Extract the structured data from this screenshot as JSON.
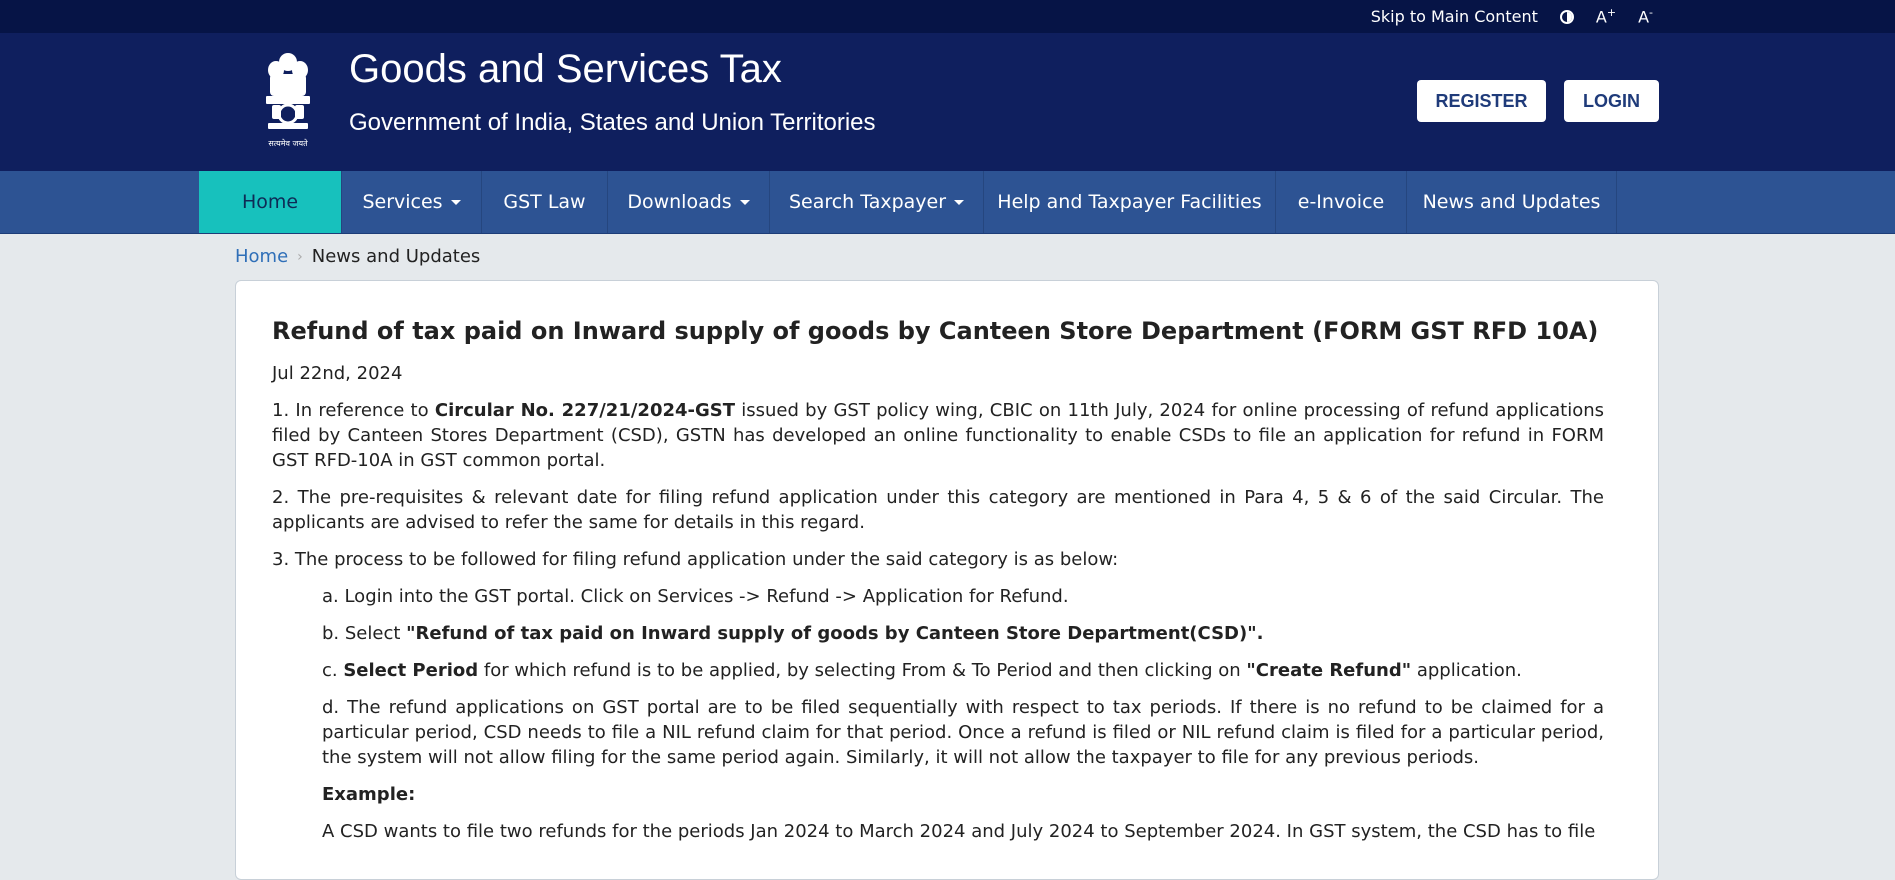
{
  "topbar": {
    "skip_link": "Skip to Main Content",
    "font_increase": "A",
    "font_increase_sup": "+",
    "font_decrease": "A",
    "font_decrease_sup": "-"
  },
  "header": {
    "title": "Goods and Services Tax",
    "subtitle": "Government of India, States and Union Territories",
    "emblem_caption": "सत्यमेव जयते",
    "register_label": "REGISTER",
    "login_label": "LOGIN"
  },
  "nav": {
    "items": [
      {
        "label": "Home",
        "active": true,
        "dropdown": false
      },
      {
        "label": "Services",
        "active": false,
        "dropdown": true
      },
      {
        "label": "GST Law",
        "active": false,
        "dropdown": false
      },
      {
        "label": "Downloads",
        "active": false,
        "dropdown": true
      },
      {
        "label": "Search Taxpayer",
        "active": false,
        "dropdown": true
      },
      {
        "label": "Help and Taxpayer Facilities",
        "active": false,
        "dropdown": false
      },
      {
        "label": "e-Invoice",
        "active": false,
        "dropdown": false
      },
      {
        "label": "News and Updates",
        "active": false,
        "dropdown": false
      }
    ]
  },
  "breadcrumb": {
    "home": "Home",
    "separator": "›",
    "current": "News and Updates"
  },
  "article": {
    "title": "Refund of tax paid on Inward supply of goods by Canteen Store Department (FORM GST RFD 10A)",
    "date": "Jul 22nd, 2024",
    "p1_a": "1.  In reference to ",
    "p1_b": "Circular No. 227/21/2024-GST",
    "p1_c": " issued by GST policy wing, CBIC on 11th July, 2024 for online processing of refund applications filed by Canteen Stores Department (CSD), GSTN has developed an online functionality to enable CSDs to file an application for refund in FORM GST RFD-10A in GST common portal.",
    "p2": "2.  The pre-requisites & relevant date for filing refund application under this category are mentioned in Para 4, 5 & 6 of the said Circular. The applicants are advised to refer the same for details in this regard.",
    "p3": "3.  The process to be followed for filing refund application under the said category is as below:",
    "step_a": "a.   Login into the GST portal. Click on Services -> Refund -> Application for Refund.",
    "step_b_a": "b.   Select ",
    "step_b_b": "\"Refund of tax paid on Inward supply of goods by Canteen Store Department(CSD)\".",
    "step_c_a": "c.   ",
    "step_c_b": "Select Period",
    "step_c_c": " for which refund is to be applied, by selecting From & To Period and then clicking on ",
    "step_c_d": "\"Create Refund\"",
    "step_c_e": " application.",
    "step_d": "d.   The refund applications on GST portal are to be filed sequentially with respect to tax periods. If there is no refund to be claimed for a particular period, CSD needs to file a NIL refund claim for that period. Once a refund is filed or NIL refund claim is filed for a particular period, the system will not allow filing for the same period again. Similarly, it will not allow the taxpayer to file for any previous periods.",
    "example_label": "Example:",
    "example_text": "A CSD wants to file two refunds for the periods Jan 2024 to March 2024 and July 2024 to September 2024. In GST system, the CSD has to file"
  }
}
